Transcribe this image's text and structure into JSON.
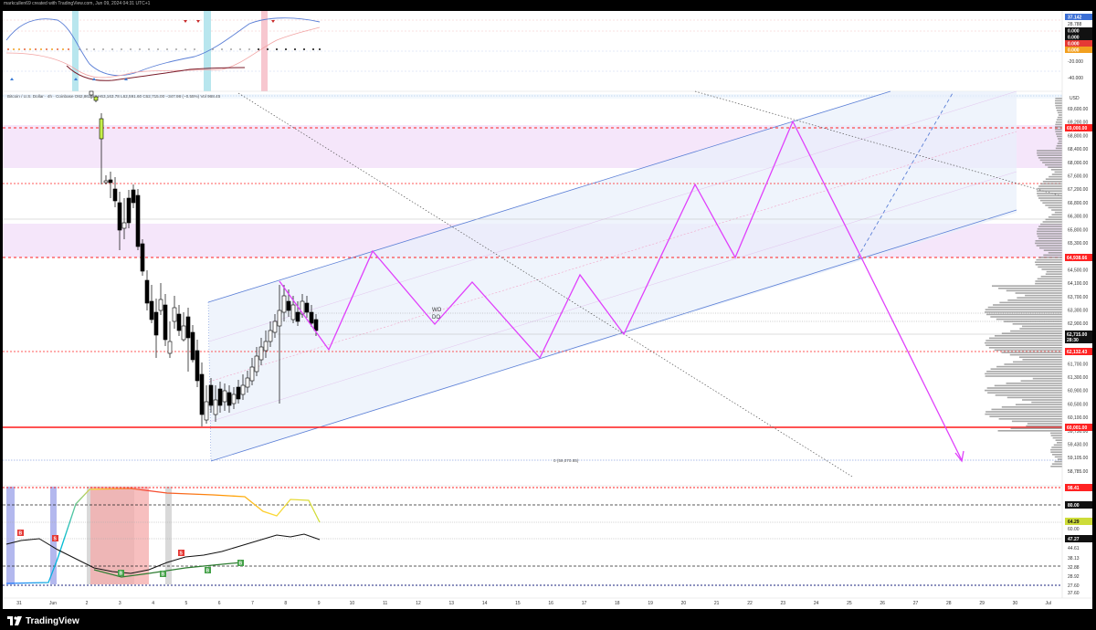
{
  "header": {
    "attribution": "markcullen69 created with TradingView.com, Jun 09, 2024 04:31 UTC+1"
  },
  "footer": {
    "brand": "TradingView"
  },
  "main_pane": {
    "legend": "Bitcoin / U.S. Dollar · 4h · Coinbase  O62,862.97  H63,163.78  L62,591.60  C62,715.00  −347.98 (−0.55%)  Vol 968.45",
    "currency": "USD",
    "price_labels": [
      "69,600.00",
      "69,200.00",
      "68,800.00",
      "68,400.00",
      "68,000.00",
      "67,600.00",
      "67,200.00",
      "66,800.00",
      "66,300.00",
      "65,800.00",
      "65,300.00",
      "64,900.00",
      "64,500.00",
      "64,100.00",
      "63,700.00",
      "63,300.00",
      "62,900.00",
      "62,500.00",
      "62,100.00",
      "61,700.00",
      "61,300.00",
      "60,900.00",
      "60,500.00",
      "60,100.00",
      "59,750.00",
      "59,430.00",
      "59,105.00",
      "58,785.00"
    ],
    "tags": {
      "level_69000": "69,000.00",
      "level_64938": "64,938.66",
      "last_price": "62,715.00",
      "countdown": "28:30",
      "level_62132": "62,132.43",
      "level_60000": "60,001.00"
    },
    "annotations": {
      "wo": "WO",
      "do": "DO",
      "fib_label": "0 (59,070.85)"
    },
    "colors": {
      "up": "#ffffff",
      "down": "#000000",
      "projection": "#e040fb",
      "channel": "#5b7fd6",
      "red_level": "#ff2222"
    }
  },
  "top_pane": {
    "values": [
      "37.142",
      "28.788",
      "0.000",
      "0.000",
      "0.000",
      "0.000"
    ],
    "scale_labels": [
      "20.000",
      "0.000",
      "-20.000",
      "-40.000"
    ]
  },
  "bottom_pane": {
    "tags": {
      "upper": "98.41",
      "level80": "80.00",
      "value": "64.29",
      "value2": "47.27"
    },
    "scale_labels": [
      "60.00",
      "44.61",
      "38.13",
      "32.88",
      "28.92",
      "27.60",
      "37.60"
    ]
  },
  "x_axis": [
    "31",
    "Jun",
    "2",
    "3",
    "4",
    "5",
    "6",
    "7",
    "8",
    "9",
    "10",
    "11",
    "12",
    "13",
    "14",
    "15",
    "16",
    "17",
    "18",
    "19",
    "20",
    "21",
    "22",
    "23",
    "24",
    "25",
    "26",
    "27",
    "28",
    "29",
    "30",
    "Jul"
  ]
}
